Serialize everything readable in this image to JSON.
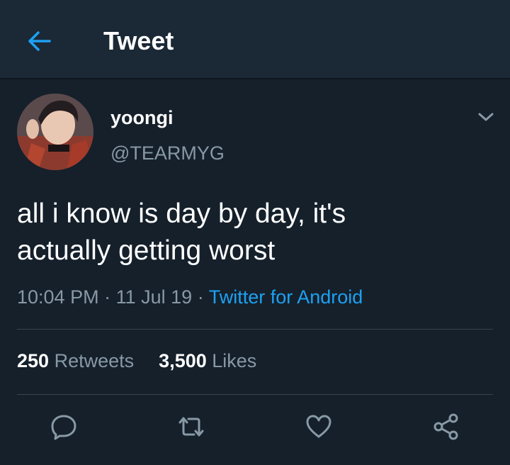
{
  "header": {
    "title": "Tweet"
  },
  "colors": {
    "accent": "#1da1f2",
    "background": "#15202b",
    "secondary_text": "#8899a6"
  },
  "tweet": {
    "display_name": "yoongi",
    "handle": "@TEARMYG",
    "text_line1": "all i know is day by day, it's",
    "text_line2": "actually getting worst",
    "time": "10:04 PM",
    "date": "11 Jul 19",
    "source": "Twitter for Android",
    "retweets_count": "250",
    "retweets_label": "Retweets",
    "likes_count": "3,500",
    "likes_label": "Likes"
  },
  "icons": {
    "back": "arrow-left-icon",
    "more": "chevron-down-icon",
    "reply": "reply-icon",
    "retweet": "retweet-icon",
    "like": "heart-icon",
    "share": "share-icon"
  }
}
